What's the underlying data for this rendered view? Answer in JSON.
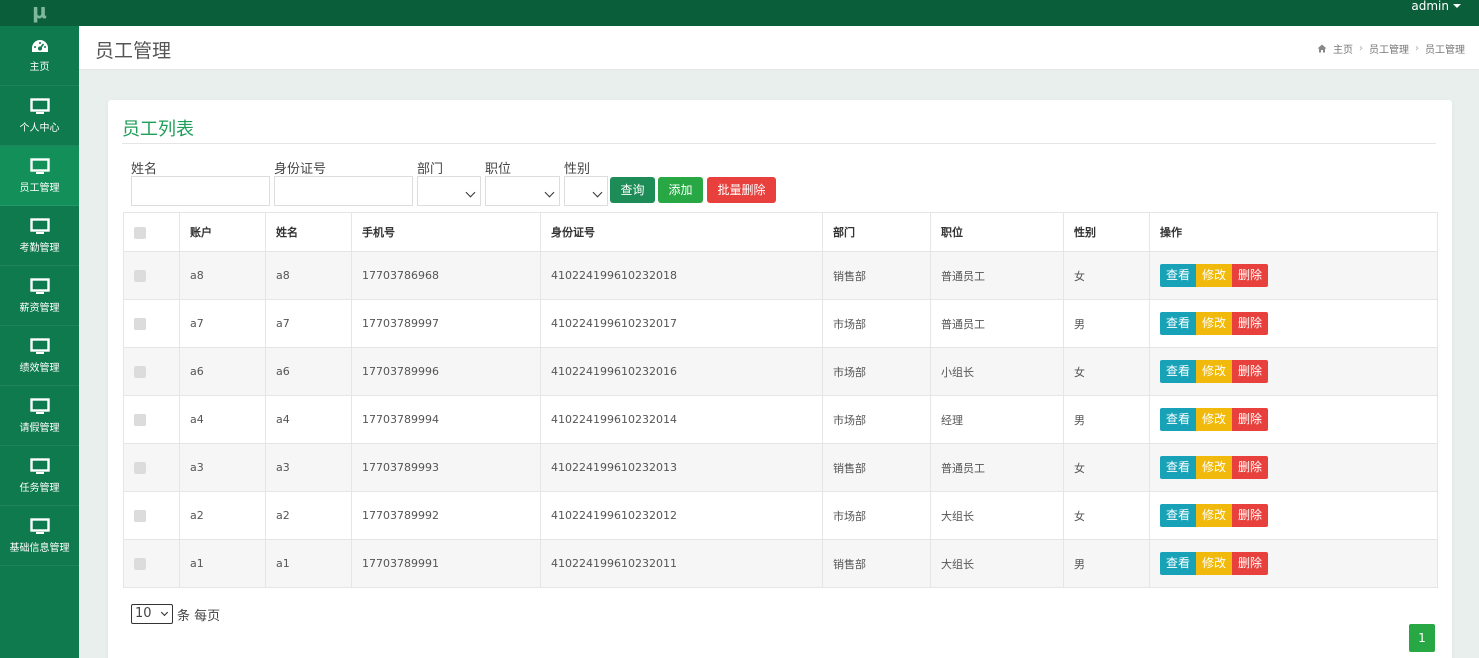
{
  "app": {
    "logo": "μ",
    "user": "admin"
  },
  "sidebar": {
    "items": [
      {
        "label": "主页",
        "icon": "dashboard-icon"
      },
      {
        "label": "个人中心",
        "icon": "monitor-icon"
      },
      {
        "label": "员工管理",
        "icon": "monitor-icon"
      },
      {
        "label": "考勤管理",
        "icon": "monitor-icon"
      },
      {
        "label": "薪资管理",
        "icon": "monitor-icon"
      },
      {
        "label": "绩效管理",
        "icon": "monitor-icon"
      },
      {
        "label": "请假管理",
        "icon": "monitor-icon"
      },
      {
        "label": "任务管理",
        "icon": "monitor-icon"
      },
      {
        "label": "基础信息管理",
        "icon": "monitor-icon"
      }
    ]
  },
  "header": {
    "title": "员工管理",
    "breadcrumb": [
      "主页",
      "员工管理",
      "员工管理"
    ]
  },
  "card": {
    "title": "员工列表",
    "filters": {
      "name_label": "姓名",
      "name_value": "",
      "idcard_label": "身份证号",
      "idcard_value": "",
      "dept_label": "部门",
      "dept_value": "",
      "position_label": "职位",
      "position_value": "",
      "gender_label": "性别",
      "gender_value": ""
    },
    "buttons": {
      "query": "查询",
      "add": "添加",
      "batch_delete": "批量删除"
    }
  },
  "table": {
    "columns": [
      "账户",
      "姓名",
      "手机号",
      "身份证号",
      "部门",
      "职位",
      "性别",
      "操作"
    ],
    "actions": {
      "view": "查看",
      "edit": "修改",
      "delete": "删除"
    },
    "rows": [
      {
        "account": "a8",
        "name": "a8",
        "phone": "17703786968",
        "idcard": "410224199610232018",
        "dept": "销售部",
        "position": "普通员工",
        "gender": "女"
      },
      {
        "account": "a7",
        "name": "a7",
        "phone": "17703789997",
        "idcard": "410224199610232017",
        "dept": "市场部",
        "position": "普通员工",
        "gender": "男"
      },
      {
        "account": "a6",
        "name": "a6",
        "phone": "17703789996",
        "idcard": "410224199610232016",
        "dept": "市场部",
        "position": "小组长",
        "gender": "女"
      },
      {
        "account": "a4",
        "name": "a4",
        "phone": "17703789994",
        "idcard": "410224199610232014",
        "dept": "市场部",
        "position": "经理",
        "gender": "男"
      },
      {
        "account": "a3",
        "name": "a3",
        "phone": "17703789993",
        "idcard": "410224199610232013",
        "dept": "销售部",
        "position": "普通员工",
        "gender": "女"
      },
      {
        "account": "a2",
        "name": "a2",
        "phone": "17703789992",
        "idcard": "410224199610232012",
        "dept": "市场部",
        "position": "大组长",
        "gender": "女"
      },
      {
        "account": "a1",
        "name": "a1",
        "phone": "17703789991",
        "idcard": "410224199610232011",
        "dept": "销售部",
        "position": "大组长",
        "gender": "男"
      }
    ]
  },
  "pagination": {
    "page_size": "10",
    "page_size_suffix": "条 每页",
    "current_page": "1"
  },
  "colors": {
    "topbar": "#0b5e3a",
    "sidebar": "#0e7a4d",
    "accent": "#1e9e58",
    "view": "#17a2b8",
    "edit": "#f0b90b",
    "delete": "#e8403c"
  }
}
